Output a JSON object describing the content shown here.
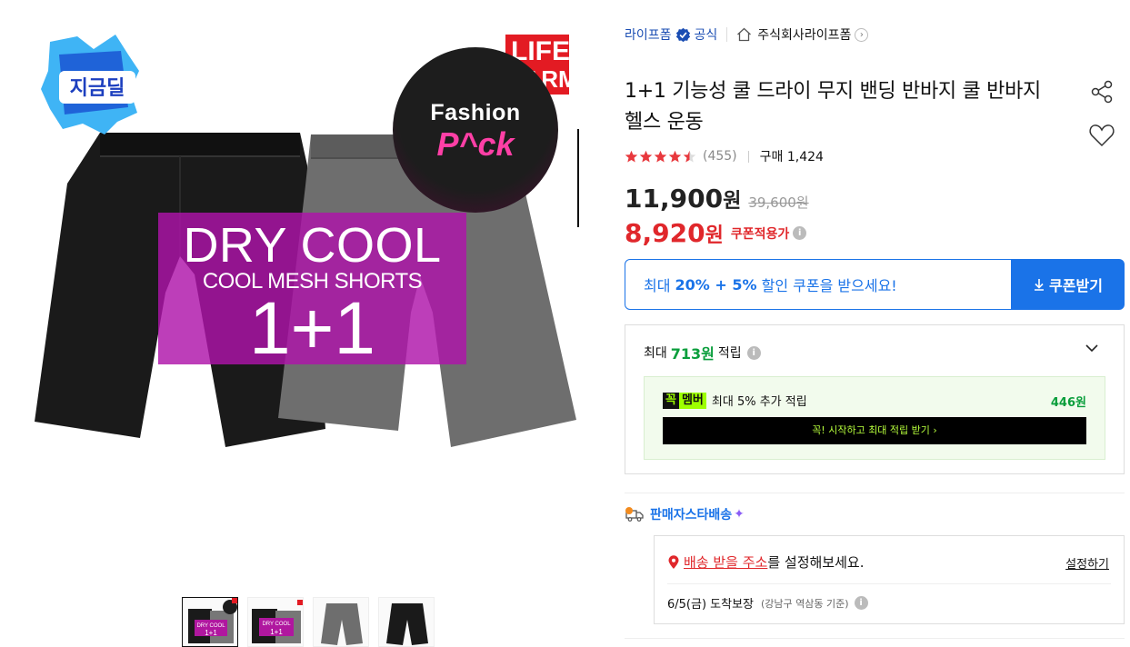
{
  "image": {
    "badge_text": "지금딜",
    "life_logo": [
      "LIFE",
      "FARM"
    ],
    "fashion_pack": [
      "Fashion",
      "P^ck"
    ],
    "promo": {
      "line1": "DRY COOL",
      "line2": "COOL MESH SHORTS",
      "line3": "1+1"
    },
    "thumb1_text": [
      "DRY COOL",
      "1+1"
    ],
    "thumb2_text": [
      "DRY COOL",
      "1+1"
    ]
  },
  "store": {
    "name": "라이프폼",
    "official": "공식",
    "company": "주식회사라이프폼"
  },
  "product": {
    "title": "1+1 기능성 쿨 드라이 무지 밴딩 반바지 쿨 반바지 헬스 운동",
    "rating": 4.5,
    "review_count": "(455)",
    "purchase_label": "구매 1,424"
  },
  "price": {
    "sale": "11,900",
    "won": "원",
    "original": "39,600원",
    "coupon_price": "8,920",
    "coupon_label": "쿠폰적용가"
  },
  "coupon_banner": {
    "prefix": "최대 ",
    "highlight": "20% + 5%",
    "suffix": " 할인 쿠폰을 받으세요!",
    "button": "쿠폰받기"
  },
  "reward": {
    "prefix": "최대",
    "amount": "713원",
    "suffix": "적립",
    "member_logo_1": "꼭",
    "member_logo_2": "멤버",
    "member_text": "최대 5% 추가 적립",
    "member_amount": "446원",
    "member_cta": "꼭! 시작하고 최대 적립 받기 ›"
  },
  "delivery": {
    "brand": "판매자스타배송",
    "address_link": "배송 받을 주소",
    "address_suffix": "를 설정해보세요.",
    "set_button": "설정하기",
    "arrival": "6/5(금) 도착보장",
    "arrival_sub": "(강남구 역삼동 기준)"
  },
  "colors": {
    "accent_blue": "#1a73e8",
    "price_red": "#e0272b",
    "reward_green": "#0a9e3c",
    "star": "#e8383d"
  }
}
